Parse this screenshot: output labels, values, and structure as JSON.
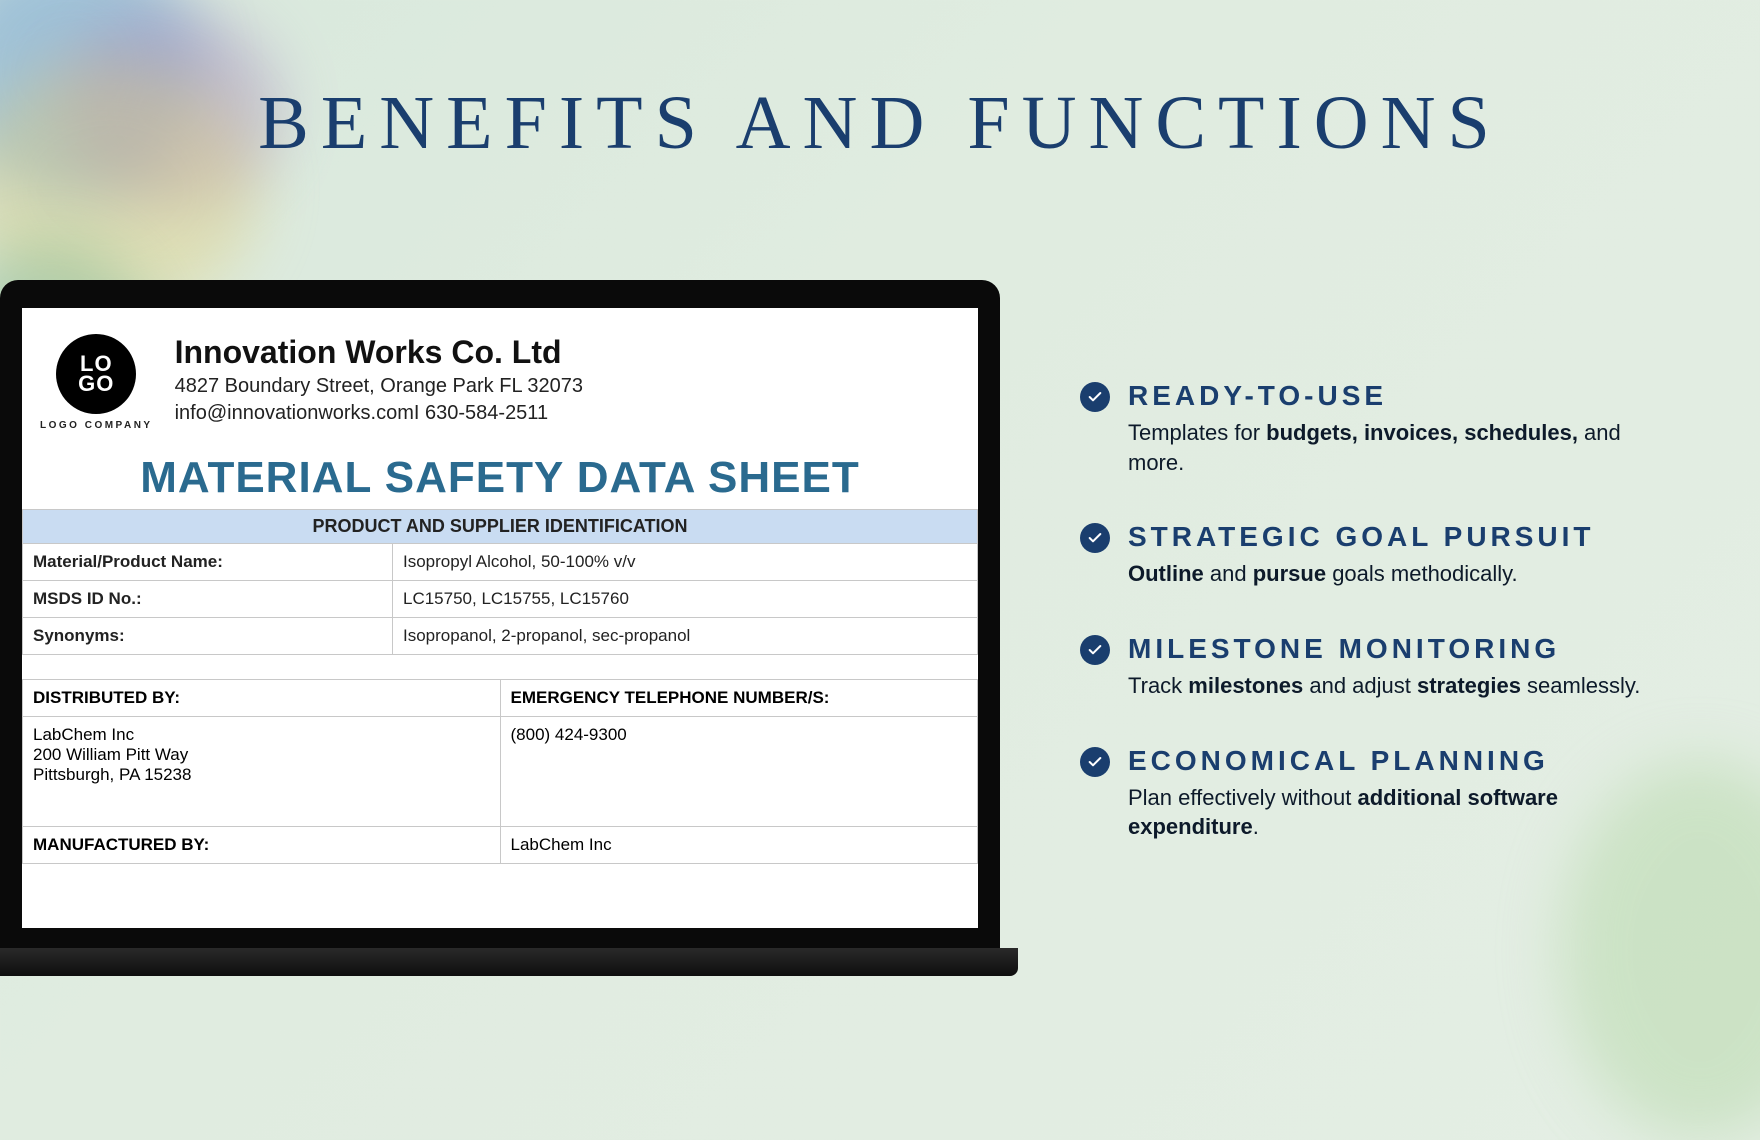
{
  "title": "BENEFITS AND FUNCTIONS",
  "document": {
    "logo_top": "LO",
    "logo_bottom": "GO",
    "logo_caption": "LOGO COMPANY",
    "company_name": "Innovation Works Co. Ltd",
    "address": "4827 Boundary Street, Orange Park FL 32073",
    "contact": "info@innovationworks.comI 630-584-2511",
    "doc_title": "MATERIAL SAFETY DATA SHEET",
    "section_heading": "PRODUCT AND SUPPLIER IDENTIFICATION",
    "rows": [
      {
        "label": "Material/Product Name:",
        "value": "Isopropyl Alcohol, 50-100% v/v"
      },
      {
        "label": "MSDS ID No.:",
        "value": "LC15750, LC15755, LC15760"
      },
      {
        "label": "Synonyms:",
        "value": "Isopropanol, 2-propanol, sec-propanol"
      }
    ],
    "distributed_by_label": "DISTRIBUTED BY:",
    "emergency_label": "EMERGENCY TELEPHONE NUMBER/S:",
    "distributed_by_name": "LabChem Inc",
    "distributed_by_street": "200 William Pitt Way",
    "distributed_by_city": "Pittsburgh, PA 15238",
    "emergency_phone": "(800) 424-9300",
    "manufactured_by_label": "MANUFACTURED BY:",
    "manufactured_by_value": "LabChem Inc"
  },
  "benefits": [
    {
      "title": "READY-TO-USE",
      "desc_pre": "Templates for ",
      "desc_bold": "budgets, invoices, schedules,",
      "desc_post": " and more."
    },
    {
      "title": "STRATEGIC GOAL PURSUIT",
      "desc_bold1": "Outline",
      "desc_mid": " and ",
      "desc_bold2": "pursue",
      "desc_post": " goals methodically."
    },
    {
      "title": "MILESTONE MONITORING",
      "desc_pre": "Track ",
      "desc_bold1": "milestones",
      "desc_mid": " and adjust ",
      "desc_bold2": "strategies",
      "desc_post": " seamlessly."
    },
    {
      "title": "ECONOMICAL PLANNING",
      "desc_pre": "Plan effectively without ",
      "desc_bold": "additional software expenditure",
      "desc_post": "."
    }
  ]
}
